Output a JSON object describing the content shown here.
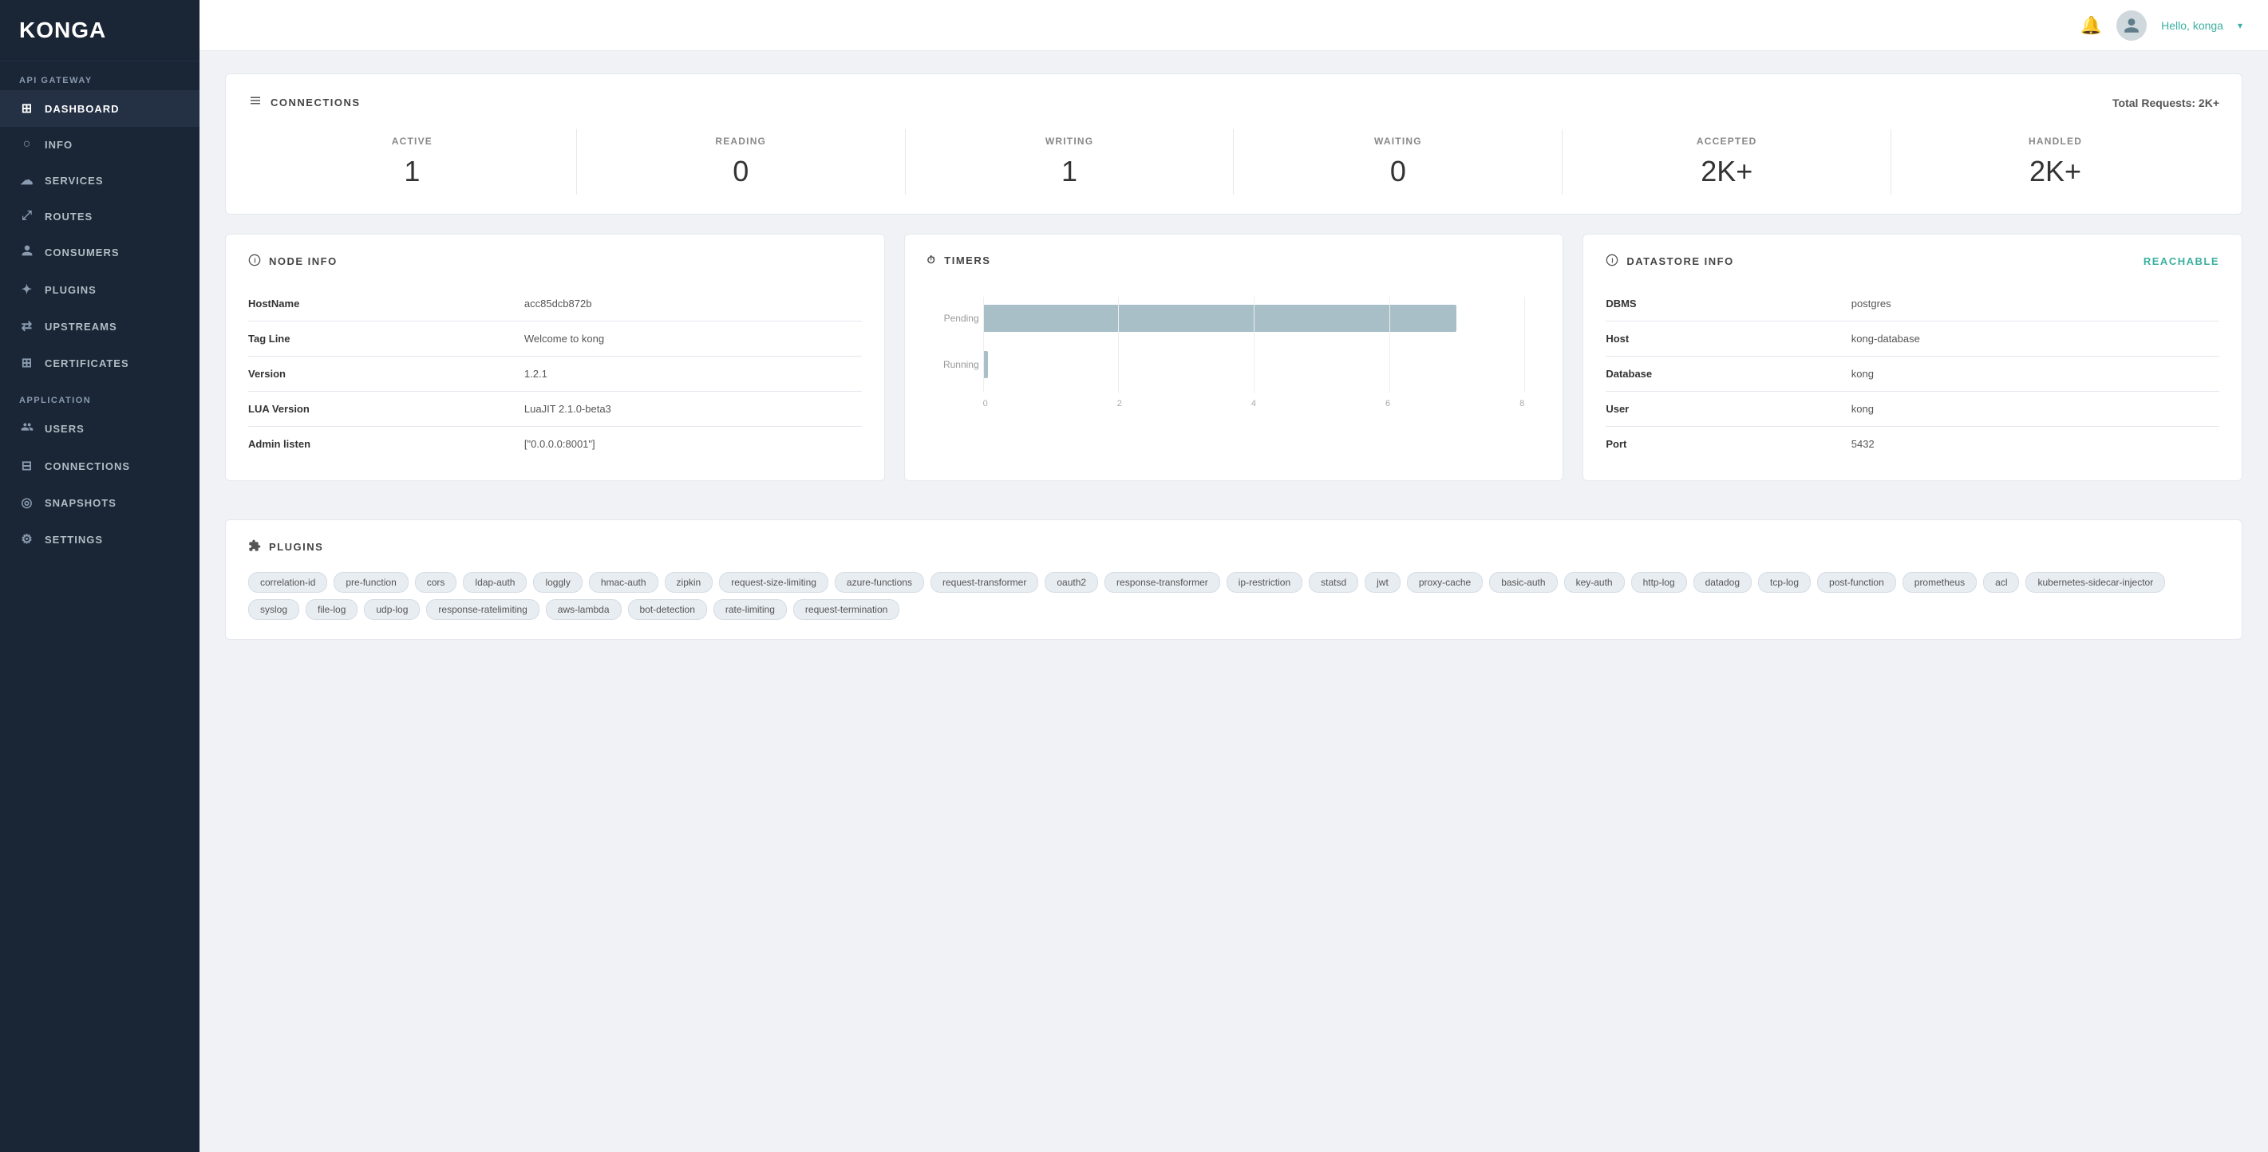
{
  "sidebar": {
    "logo": "KONGA",
    "api_gateway_label": "API GATEWAY",
    "application_label": "APPLICATION",
    "nav_items": [
      {
        "id": "dashboard",
        "label": "DASHBOARD",
        "icon": "⊞",
        "active": true
      },
      {
        "id": "info",
        "label": "INFO",
        "icon": "○"
      },
      {
        "id": "services",
        "label": "SERVICES",
        "icon": "☁"
      },
      {
        "id": "routes",
        "label": "ROUTES",
        "icon": "⤢"
      },
      {
        "id": "consumers",
        "label": "CONSUMERS",
        "icon": "👤"
      },
      {
        "id": "plugins",
        "label": "PLUGINS",
        "icon": "✦"
      },
      {
        "id": "upstreams",
        "label": "UPSTREAMS",
        "icon": "⇄"
      },
      {
        "id": "certificates",
        "label": "CERTIFICATES",
        "icon": "⊞"
      },
      {
        "id": "users",
        "label": "USERS",
        "icon": "👥"
      },
      {
        "id": "connections",
        "label": "CONNECTIONS",
        "icon": "⊟"
      },
      {
        "id": "snapshots",
        "label": "SNAPSHOTS",
        "icon": "◎"
      },
      {
        "id": "settings",
        "label": "SETTINGS",
        "icon": "⚙"
      }
    ]
  },
  "topbar": {
    "user_label": "Hello, konga",
    "caret": "▾"
  },
  "connections_section": {
    "title": "CONNECTIONS",
    "total_requests_label": "Total Requests:",
    "total_requests_value": "2K+",
    "stats": [
      {
        "label": "ACTIVE",
        "value": "1"
      },
      {
        "label": "READING",
        "value": "0"
      },
      {
        "label": "WRITING",
        "value": "1"
      },
      {
        "label": "WAITING",
        "value": "0"
      },
      {
        "label": "ACCEPTED",
        "value": "2K+"
      },
      {
        "label": "HANDLED",
        "value": "2K+"
      }
    ]
  },
  "node_info": {
    "title": "NODE INFO",
    "rows": [
      {
        "label": "HostName",
        "value": "acc85dcb872b"
      },
      {
        "label": "Tag Line",
        "value": "Welcome to kong"
      },
      {
        "label": "Version",
        "value": "1.2.1"
      },
      {
        "label": "LUA Version",
        "value": "LuaJIT 2.1.0-beta3"
      },
      {
        "label": "Admin listen",
        "value": "[\"0.0.0.0:8001\"]"
      }
    ]
  },
  "timers": {
    "title": "TIMERS",
    "bars": [
      {
        "label": "Pending",
        "value": 7,
        "max": 8
      },
      {
        "label": "Running",
        "value": 0.1,
        "max": 8
      }
    ],
    "axis": [
      "0",
      "2",
      "4",
      "6",
      "8"
    ]
  },
  "datastore_info": {
    "title": "DATASTORE INFO",
    "status": "Reachable",
    "rows": [
      {
        "label": "DBMS",
        "value": "postgres"
      },
      {
        "label": "Host",
        "value": "kong-database"
      },
      {
        "label": "Database",
        "value": "kong"
      },
      {
        "label": "User",
        "value": "kong"
      },
      {
        "label": "Port",
        "value": "5432"
      }
    ]
  },
  "plugins": {
    "title": "PLUGINS",
    "tags": [
      "correlation-id",
      "pre-function",
      "cors",
      "ldap-auth",
      "loggly",
      "hmac-auth",
      "zipkin",
      "request-size-limiting",
      "azure-functions",
      "request-transformer",
      "oauth2",
      "response-transformer",
      "ip-restriction",
      "statsd",
      "jwt",
      "proxy-cache",
      "basic-auth",
      "key-auth",
      "http-log",
      "datadog",
      "tcp-log",
      "post-function",
      "prometheus",
      "acl",
      "kubernetes-sidecar-injector",
      "syslog",
      "file-log",
      "udp-log",
      "response-ratelimiting",
      "aws-lambda",
      "bot-detection",
      "rate-limiting",
      "request-termination"
    ]
  }
}
